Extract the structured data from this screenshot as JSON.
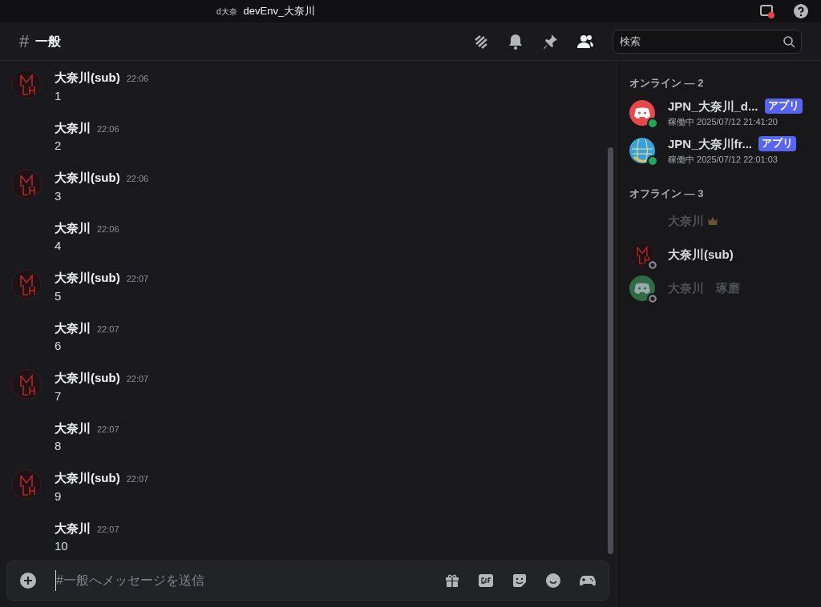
{
  "titlebar": {
    "server_badge": "d大奈",
    "title": "devEnv_大奈川"
  },
  "channel": {
    "hash": "#",
    "name": "一般"
  },
  "search": {
    "placeholder": "検索"
  },
  "messages": [
    {
      "author": "大奈川(sub)",
      "time": "22:06",
      "text": "1",
      "kind": "avatar"
    },
    {
      "author": "大奈川",
      "time": "22:06",
      "text": "2",
      "kind": "plain"
    },
    {
      "author": "大奈川(sub)",
      "time": "22:06",
      "text": "3",
      "kind": "avatar"
    },
    {
      "author": "大奈川",
      "time": "22:06",
      "text": "4",
      "kind": "plain"
    },
    {
      "author": "大奈川(sub)",
      "time": "22:07",
      "text": "5",
      "kind": "avatar"
    },
    {
      "author": "大奈川",
      "time": "22:07",
      "text": "6",
      "kind": "plain"
    },
    {
      "author": "大奈川(sub)",
      "time": "22:07",
      "text": "7",
      "kind": "avatar"
    },
    {
      "author": "大奈川",
      "time": "22:07",
      "text": "8",
      "kind": "plain"
    },
    {
      "author": "大奈川(sub)",
      "time": "22:07",
      "text": "9",
      "kind": "avatar"
    },
    {
      "author": "大奈川",
      "time": "22:07",
      "text": "10",
      "kind": "plain"
    }
  ],
  "composer": {
    "placeholder": "#一般へメッセージを送信"
  },
  "member_groups": [
    {
      "title": "オンライン — 2",
      "members": [
        {
          "name": "JPN_大奈川_d...",
          "badge": "アプリ",
          "status_text": "稼働中 2025/07/12 21:41:20",
          "kind": "discord",
          "color": "#e5484d",
          "online": true,
          "dimmed": false
        },
        {
          "name": "JPN_大奈川fr...",
          "badge": "アプリ",
          "status_text": "稼働中 2025/07/12 22:01:03",
          "kind": "globe",
          "color": "#3aa0d8",
          "online": true,
          "dimmed": false
        }
      ]
    },
    {
      "title": "オフライン — 3",
      "members": [
        {
          "name": "大奈川",
          "kind": "blank",
          "owner": true,
          "dimmed": true
        },
        {
          "name": "大奈川(sub)",
          "kind": "monogram",
          "online": false,
          "dimmed": false
        },
        {
          "name": "大奈川　琢磨",
          "kind": "discord",
          "color": "#2f6b45",
          "online": false,
          "dimmed": true
        }
      ]
    }
  ]
}
